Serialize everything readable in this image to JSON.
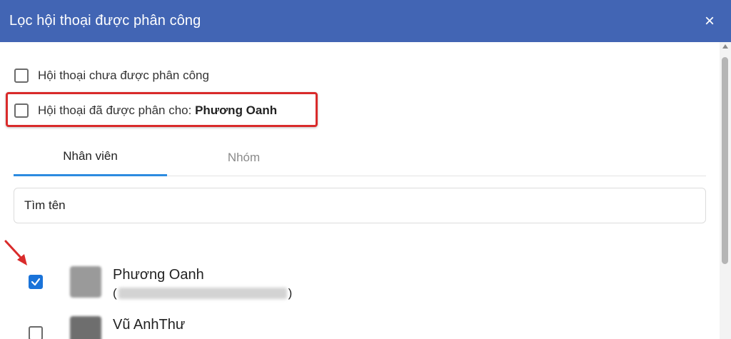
{
  "header": {
    "title": "Lọc hội thoại được phân công",
    "close_icon": "×"
  },
  "filters": {
    "unassigned_label": "Hội thoại chưa được phân công",
    "assigned_label": "Hội thoại đã được phân cho: ",
    "assigned_name": "Phương Oanh"
  },
  "tabs": [
    {
      "label": "Nhân viên",
      "active": true
    },
    {
      "label": "Nhóm",
      "active": false
    }
  ],
  "search": {
    "placeholder": "Tìm tên"
  },
  "staff": [
    {
      "name": "Phương Oanh",
      "sub_open": "(",
      "sub_close": ")",
      "checked": true
    },
    {
      "name": "Vũ AnhThư",
      "checked": false
    }
  ],
  "colors": {
    "header_bg": "#4265b4",
    "highlight": "#d92b2b",
    "checkbox_checked": "#1a73d9",
    "tab_underline": "#2c8be0"
  }
}
